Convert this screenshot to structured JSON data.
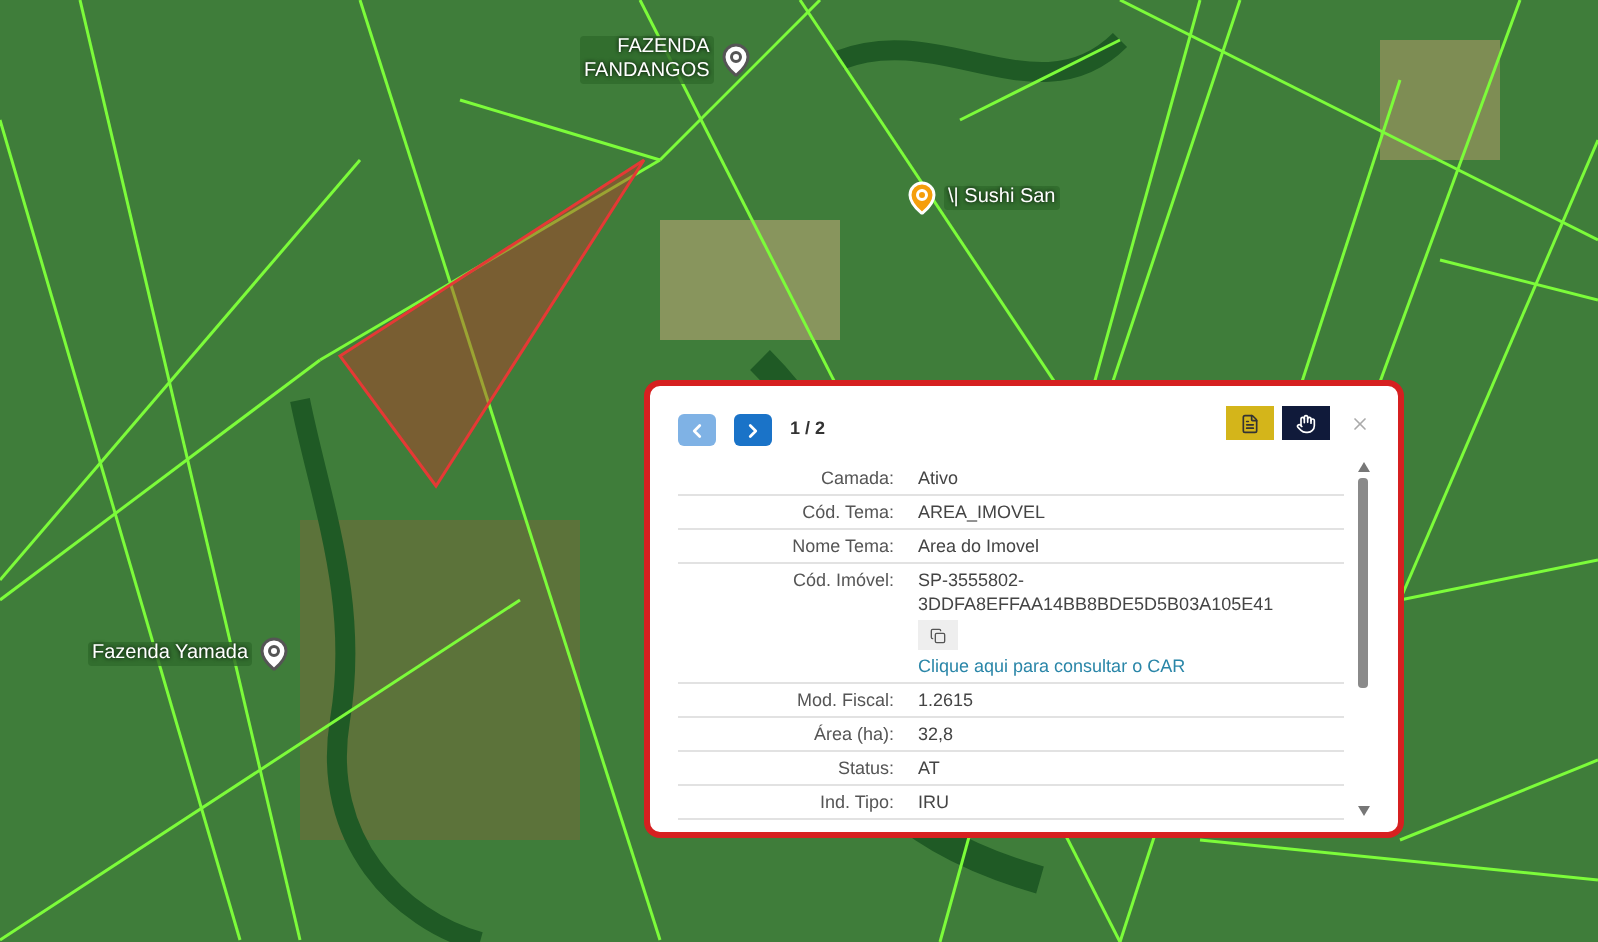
{
  "map": {
    "places": [
      {
        "kind": "farm",
        "lines": [
          "FAZENDA",
          "FANDANGOS"
        ]
      },
      {
        "kind": "restaurant",
        "lines": [
          "\\| Sushi San"
        ]
      },
      {
        "kind": "farm_left",
        "lines": [
          "Fazenda Yamada"
        ]
      }
    ]
  },
  "popup": {
    "pager": "1 / 2",
    "prev_enabled": false,
    "next_enabled": true,
    "rows": [
      {
        "kind": "text",
        "label": "Camada:",
        "value": "Ativo"
      },
      {
        "kind": "text",
        "label": "Cód. Tema:",
        "value": "AREA_IMOVEL"
      },
      {
        "kind": "text",
        "label": "Nome Tema:",
        "value": "Area do Imovel"
      },
      {
        "kind": "car",
        "label": "Cód. Imóvel:",
        "value": "SP-3555802-\n3DDFA8EFFAA14BB8BDE5D5B03A105E41",
        "link": "Clique aqui para consultar o CAR"
      },
      {
        "kind": "text",
        "label": "Mod. Fiscal:",
        "value": "1.2615"
      },
      {
        "kind": "text",
        "label": "Área (ha):",
        "value": "32,8"
      },
      {
        "kind": "text",
        "label": "Status:",
        "value": "AT"
      },
      {
        "kind": "text",
        "label": "Ind. Tipo:",
        "value": "IRU"
      }
    ]
  }
}
